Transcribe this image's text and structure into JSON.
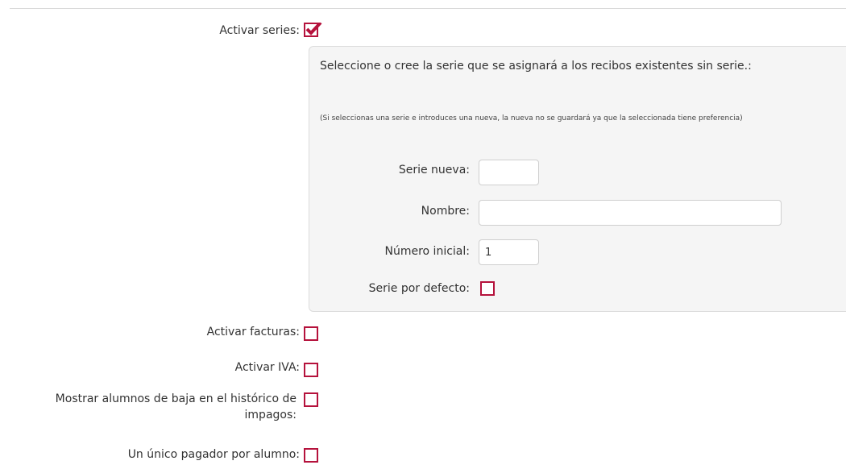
{
  "settings": {
    "series": {
      "label": "Activar series:",
      "checked": true
    },
    "panel": {
      "title": "Seleccione o cree la serie que se asignará a los recibos existentes sin serie.:",
      "note": "(Si seleccionas una serie e introduces una nueva, la nueva no se guardará ya que la seleccionada tiene preferencia)",
      "new_series_label": "Serie nueva:",
      "new_series_value": "",
      "name_label": "Nombre:",
      "name_value": "",
      "start_number_label": "Número inicial:",
      "start_number_value": "1",
      "default_series_label": "Serie por defecto:",
      "default_series_checked": false
    },
    "invoices": {
      "label": "Activar facturas:",
      "checked": false
    },
    "vat": {
      "label": "Activar IVA:",
      "checked": false
    },
    "show_dropped_students": {
      "label": "Mostrar alumnos de baja en el histórico de impagos:",
      "checked": false
    },
    "single_payer": {
      "label": "Un único pagador por alumno:",
      "checked": false
    }
  },
  "colors": {
    "accent": "#b5123c",
    "panel_background": "#f5f5f5",
    "panel_border": "#dcdcdc"
  }
}
